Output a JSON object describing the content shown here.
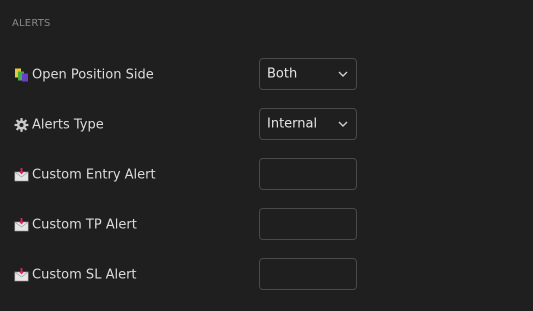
{
  "section": {
    "title": "ALERTS"
  },
  "fields": {
    "open_position_side": {
      "label": "Open Position Side",
      "value": "Both",
      "icon": "position-side-icon"
    },
    "alerts_type": {
      "label": "Alerts Type",
      "value": "Internal",
      "icon": "gear-icon"
    },
    "custom_entry_alert": {
      "label": "Custom Entry Alert",
      "value": "",
      "icon": "envelope-alert-icon"
    },
    "custom_tp_alert": {
      "label": "Custom TP Alert",
      "value": "",
      "icon": "envelope-alert-icon"
    },
    "custom_sl_alert": {
      "label": "Custom SL Alert",
      "value": "",
      "icon": "envelope-alert-icon"
    }
  },
  "colors": {
    "background": "#1f1f1f",
    "border": "#4a4a4a",
    "text": "#dcdcdc",
    "muted": "#8a8a8a",
    "envelope_arrow": "#e0245e"
  }
}
